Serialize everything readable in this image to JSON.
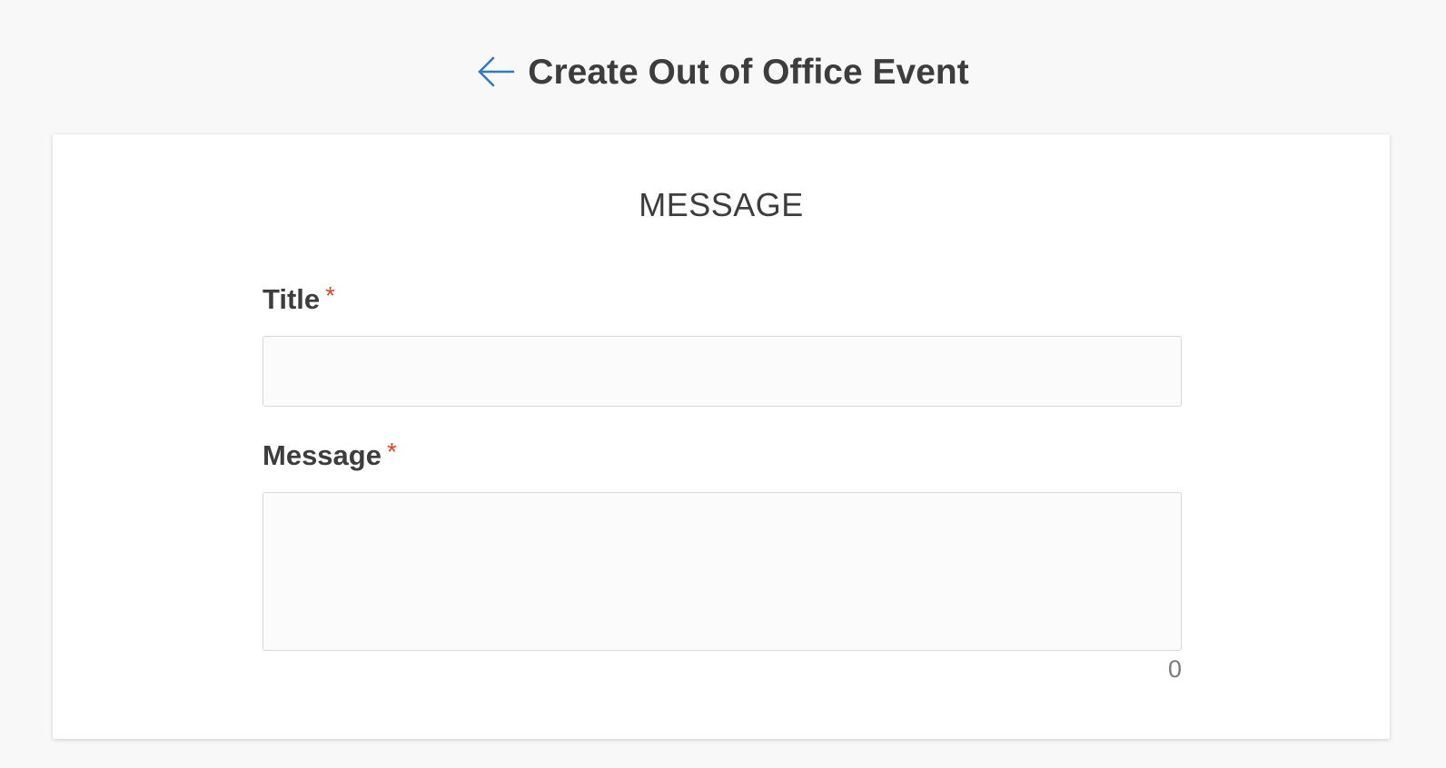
{
  "header": {
    "title": "Create Out of Office Event",
    "back_icon": "arrow-left-icon",
    "accent_color": "#2f7bbf"
  },
  "form": {
    "section_title": "MESSAGE",
    "title_field": {
      "label": "Title",
      "required_mark": "*",
      "value": "",
      "placeholder": ""
    },
    "message_field": {
      "label": "Message",
      "required_mark": "*",
      "value": "",
      "placeholder": "",
      "char_count": "0"
    }
  },
  "colors": {
    "background": "#f8f8f8",
    "card": "#ffffff",
    "text": "#3d3d3d",
    "required": "#d9472b",
    "input_border": "#d9d9d9"
  }
}
